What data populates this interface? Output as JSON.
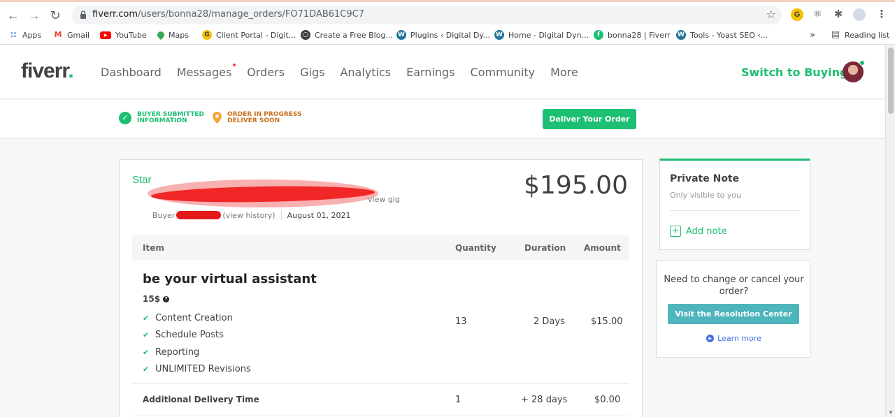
{
  "browser": {
    "url_host": "fiverr.com",
    "url_path": "/users/bonna28/manage_orders/FO71DAB61C9C7",
    "bookmarks": [
      {
        "label": "Apps",
        "icon": "apps-grid-icon"
      },
      {
        "label": "Gmail",
        "icon": "gmail-icon"
      },
      {
        "label": "YouTube",
        "icon": "youtube-icon"
      },
      {
        "label": "Maps",
        "icon": "maps-icon"
      },
      {
        "label": "Client Portal - Digit...",
        "icon": "g-circle-icon"
      },
      {
        "label": "Create a Free Blog...",
        "icon": "globe-icon"
      },
      {
        "label": "Plugins ‹ Digital Dy...",
        "icon": "wordpress-icon"
      },
      {
        "label": "Home - Digital Dyn...",
        "icon": "wordpress-icon"
      },
      {
        "label": "bonna28 | Fiverr",
        "icon": "fiverr-icon"
      },
      {
        "label": "Tools - Yoast SEO ‹...",
        "icon": "wordpress-icon"
      }
    ],
    "bookmarks_overflow": "»",
    "reading_list": "Reading list"
  },
  "header": {
    "logo": "fiverr",
    "logo_dot": ".",
    "nav": [
      "Dashboard",
      "Messages",
      "Orders",
      "Gigs",
      "Analytics",
      "Earnings",
      "Community",
      "More"
    ],
    "switch_label": "Switch to Buying"
  },
  "status": {
    "step1": "BUYER SUBMITTED\nINFORMATION",
    "step2": "ORDER IN PROGRESS\nDELIVER SOON",
    "deliver_button": "Deliver Your Order"
  },
  "order": {
    "gig_prefix": "Star",
    "view_gig": "view gig",
    "buyer_label": "Buyer",
    "view_history": "(view history)",
    "date": "August 01, 2021",
    "price": "$195.00",
    "columns": {
      "item": "Item",
      "quantity": "Quantity",
      "duration": "Duration",
      "amount": "Amount"
    },
    "item": {
      "title": "be your virtual assistant",
      "package": "15$",
      "features": [
        "Content Creation",
        "Schedule Posts",
        "Reporting",
        "UNLIMITED Revisions"
      ],
      "quantity": "13",
      "duration": "2 Days",
      "amount": "$15.00"
    },
    "extra": {
      "label": "Additional Delivery Time",
      "quantity": "1",
      "duration": "+ 28 days",
      "amount": "$0.00"
    }
  },
  "private_note": {
    "title": "Private Note",
    "subtitle": "Only visible to you",
    "add_label": "Add note"
  },
  "resolution": {
    "text": "Need to change or cancel your order?",
    "button": "Visit the Resolution Center",
    "learn_more": "Learn more"
  },
  "colors": {
    "brand_green": "#1dbf73",
    "resolution_teal": "#4fb5bd",
    "step_orange": "#f4a533",
    "link_blue": "#446ee7"
  }
}
